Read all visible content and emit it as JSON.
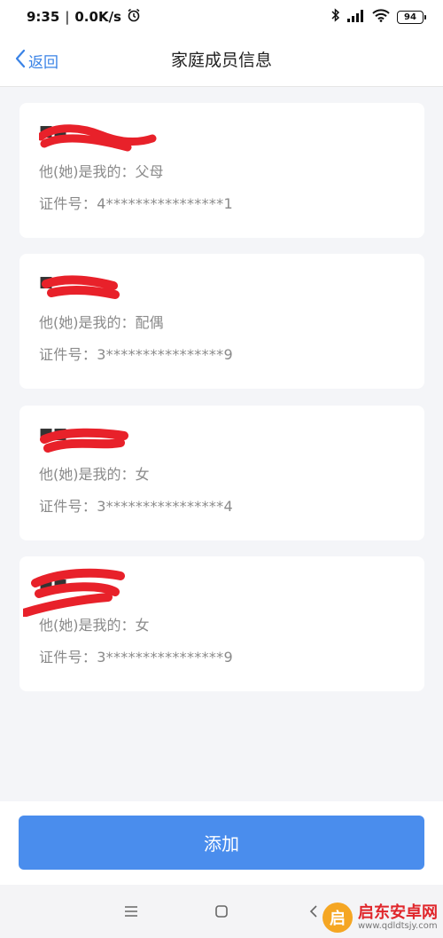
{
  "status_bar": {
    "time": "9:35",
    "net_speed": "0.0K/s",
    "battery": "94",
    "icons": [
      "alarm-icon",
      "bluetooth-icon",
      "signal-icon",
      "wifi-icon",
      "battery-icon"
    ]
  },
  "header": {
    "back_label": "返回",
    "title": "家庭成员信息"
  },
  "members": [
    {
      "relation": "他(她)是我的：父母",
      "id": "证件号：4****************1"
    },
    {
      "relation": "他(她)是我的：配偶",
      "id": "证件号：3****************9"
    },
    {
      "relation": "他(她)是我的：女",
      "id": "证件号：3****************4"
    },
    {
      "relation": "他(她)是我的：女",
      "id": "证件号：3****************9"
    }
  ],
  "actions": {
    "add_label": "添加"
  },
  "system_nav": {
    "icons": [
      "menu-icon",
      "home-icon",
      "back-icon"
    ]
  },
  "watermark": {
    "title": "启东安卓网",
    "url": "www.qdldtsjy.com",
    "accent": "#e0262b"
  },
  "colors": {
    "accent": "#4a8ded",
    "link": "#3a83e6",
    "redaction": "#e8212a"
  }
}
